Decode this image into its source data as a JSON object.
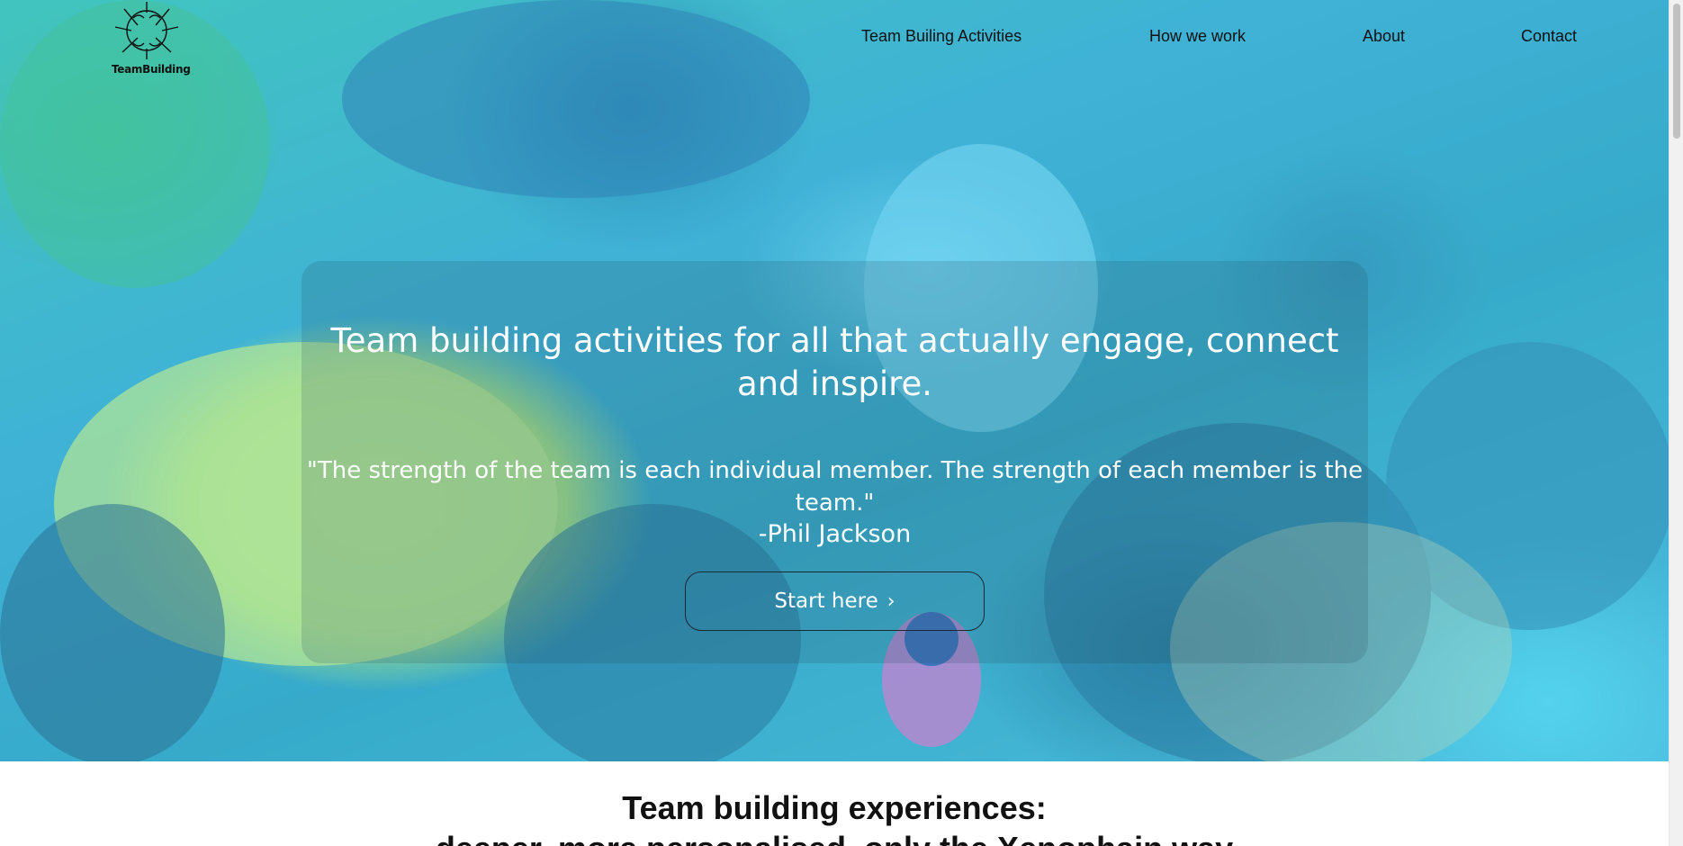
{
  "logo": {
    "text": "TeamBuilding",
    "icon": "hands-circle-icon"
  },
  "nav": {
    "items": [
      {
        "label": "Team Builing Activities"
      },
      {
        "label": "How we work"
      },
      {
        "label": "About"
      },
      {
        "label": "Contact"
      }
    ]
  },
  "hero": {
    "headline": "Team building activities for all that actually engage, connect and inspire.",
    "quote": "\"The strength of the team is each individual member. The strength of each member is the team.\"",
    "author": "-Phil Jackson",
    "cta_label": "Start here",
    "cta_icon": "chevron-right-icon"
  },
  "section": {
    "title": "Team building experiences:",
    "subtitle": "deeper, more personalised, only the Xenophain way"
  },
  "colors": {
    "overlay": "#50c8eb",
    "text_light": "#ffffff",
    "text_dark": "#111111"
  }
}
